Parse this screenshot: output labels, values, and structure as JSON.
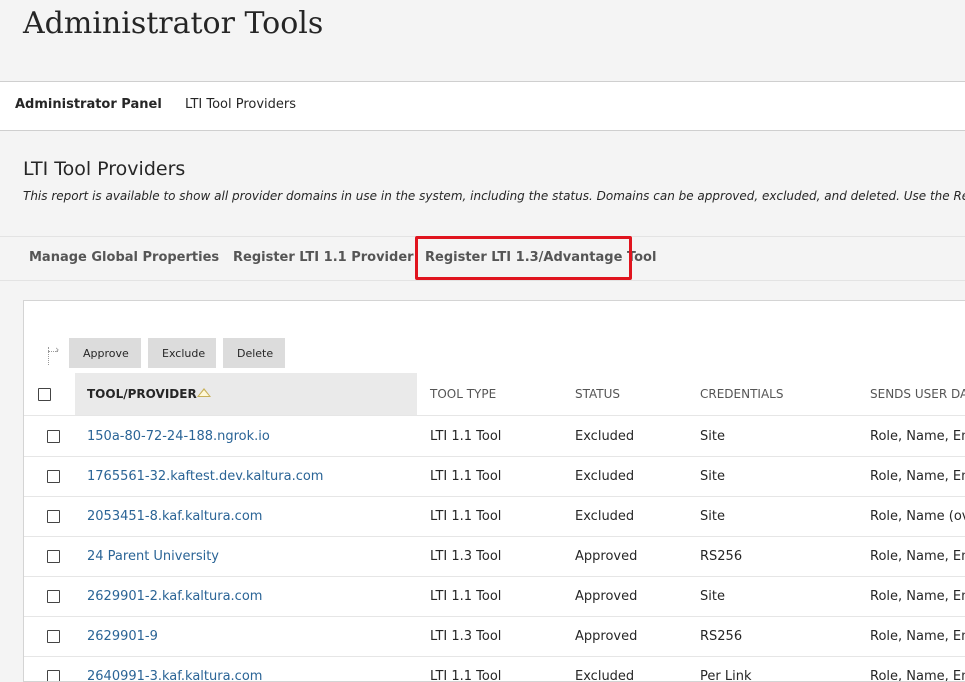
{
  "header": {
    "title": "Administrator Tools"
  },
  "breadcrumb": {
    "parent": "Administrator Panel",
    "current": "LTI Tool Providers"
  },
  "section": {
    "title": "LTI Tool Providers",
    "description": "This report is available to show all provider domains in use in the system, including the status. Domains can be approved, excluded, and deleted. Use the Register Provid"
  },
  "actions": {
    "manage_global": "Manage Global Properties",
    "register_11": "Register LTI 1.1 Provider",
    "register_13": "Register LTI 1.3/Advantage Tool",
    "highlight_color": "#e0141e"
  },
  "bulk": {
    "approve": "Approve",
    "exclude": "Exclude",
    "delete": "Delete"
  },
  "table": {
    "columns": [
      "TOOL/PROVIDER",
      "TOOL TYPE",
      "STATUS",
      "CREDENTIALS",
      "SENDS USER DA"
    ],
    "rows": [
      [
        "150a-80-72-24-188.ngrok.io",
        "LTI 1.1 Tool",
        "Excluded",
        "Site",
        "Role, Name, Em"
      ],
      [
        "1765561-32.kaftest.dev.kaltura.com",
        "LTI 1.1 Tool",
        "Excluded",
        "Site",
        "Role, Name, Em"
      ],
      [
        "2053451-8.kaf.kaltura.com",
        "LTI 1.1 Tool",
        "Excluded",
        "Site",
        "Role, Name (ove"
      ],
      [
        "24 Parent University",
        "LTI 1.3 Tool",
        "Approved",
        "RS256",
        "Role, Name, Em"
      ],
      [
        "2629901-2.kaf.kaltura.com",
        "LTI 1.1 Tool",
        "Approved",
        "Site",
        "Role, Name, Em"
      ],
      [
        "2629901-9",
        "LTI 1.3 Tool",
        "Approved",
        "RS256",
        "Role, Name, Em"
      ],
      [
        "2640991-3.kaf.kaltura.com",
        "LTI 1.1 Tool",
        "Excluded",
        "Per Link",
        "Role, Name, Em"
      ]
    ]
  }
}
